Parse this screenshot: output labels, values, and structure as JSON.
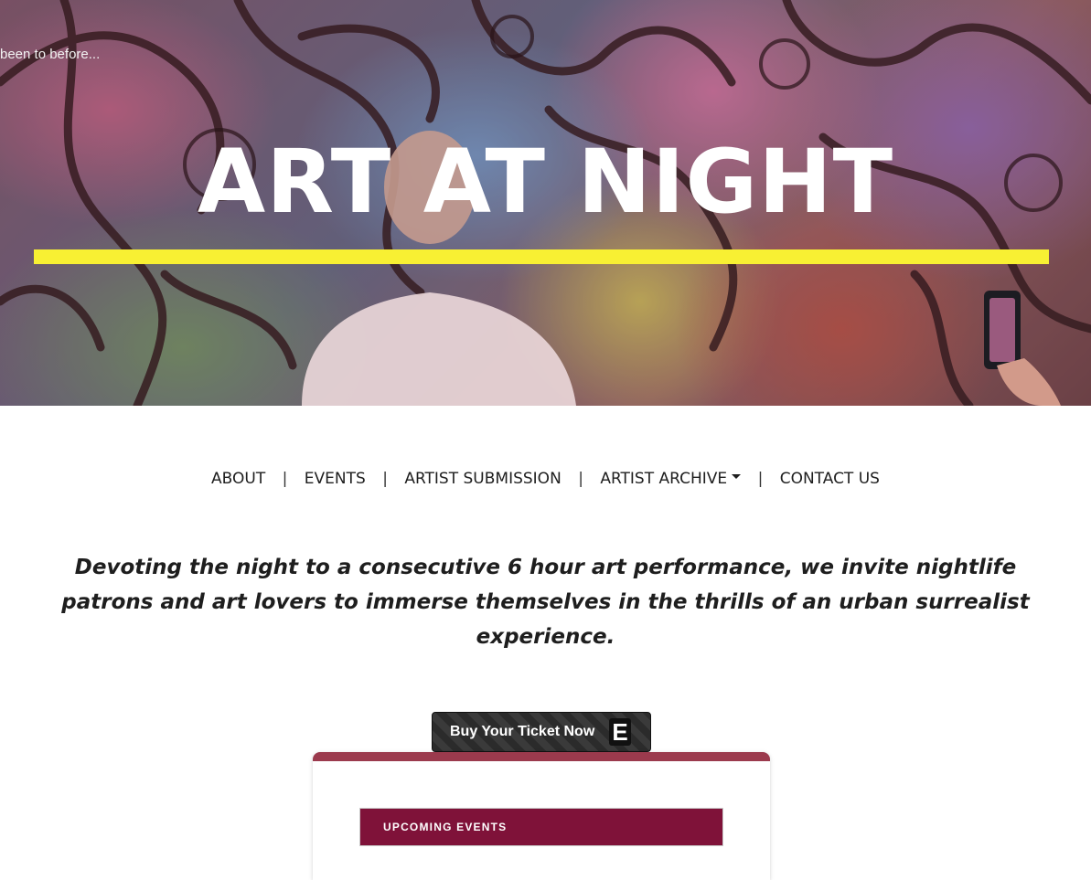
{
  "hero": {
    "tagline": "been to before...",
    "title": "ART AT NIGHT",
    "accent_color": "#f8f033"
  },
  "nav": {
    "items": [
      {
        "label": "ABOUT"
      },
      {
        "label": "EVENTS"
      },
      {
        "label": "ARTIST SUBMISSION"
      },
      {
        "label": "ARTIST ARCHIVE",
        "has_dropdown": true
      },
      {
        "label": "CONTACT US"
      }
    ],
    "separator": "|"
  },
  "intro": {
    "text": "Devoting the night to a consecutive 6 hour art performance, we invite nightlife patrons and art lovers to immerse themselves in the thrills of an urban surrealist experience."
  },
  "ticket_button": {
    "label": "Buy Your Ticket Now",
    "logo_letter": "E",
    "logo_icon": "eventbrite-icon"
  },
  "events_widget": {
    "header": "UPCOMING EVENTS",
    "accent_color": "#9b3a4d",
    "header_color": "#7f1239"
  }
}
